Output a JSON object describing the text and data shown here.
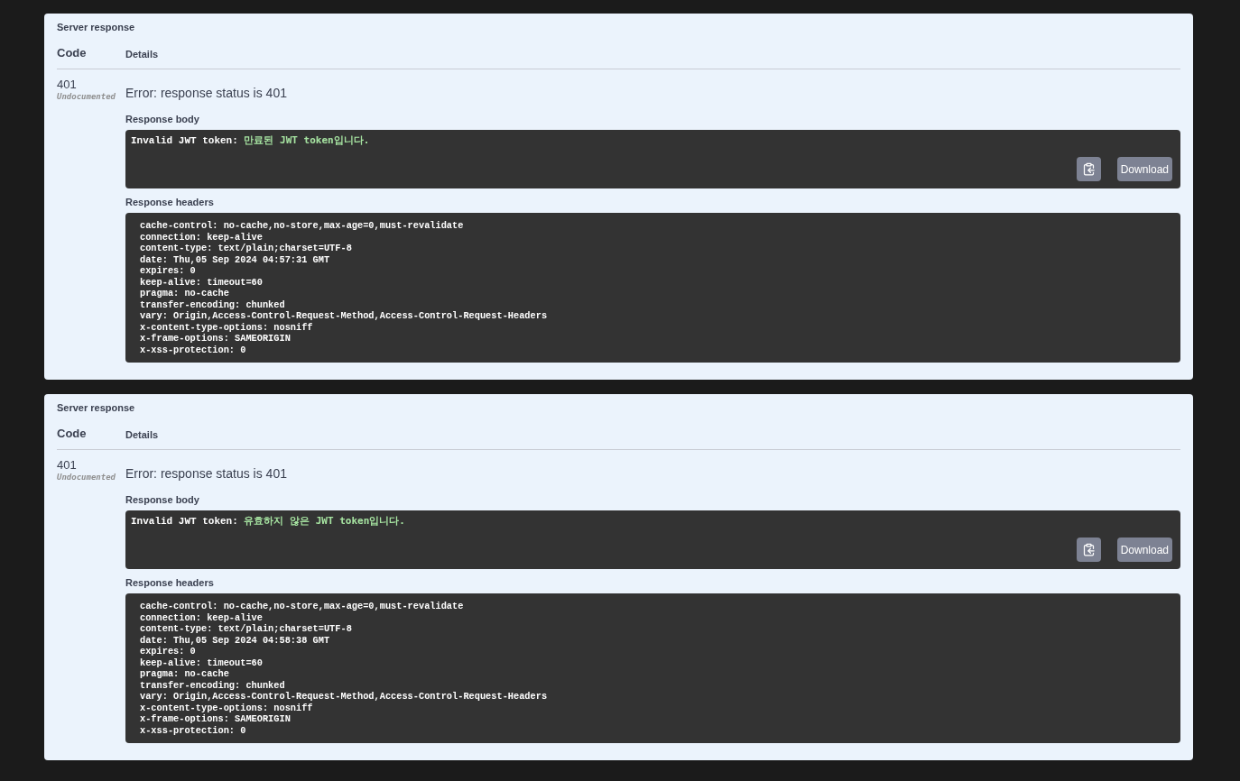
{
  "responses": [
    {
      "section_title": "Server response",
      "columns": [
        "Code",
        "Details"
      ],
      "code": "401",
      "code_note": "Undocumented",
      "error": "Error: response status is 401",
      "body_label": "Response body",
      "body": {
        "prefix": "Invalid JWT token: ",
        "message": "만료된 JWT token입니다."
      },
      "download": "Download",
      "headers_label": "Response headers",
      "headers": [
        "cache-control: no-cache,no-store,max-age=0,must-revalidate",
        "connection: keep-alive",
        "content-type: text/plain;charset=UTF-8",
        "date: Thu,05 Sep 2024 04:57:31 GMT",
        "expires: 0",
        "keep-alive: timeout=60",
        "pragma: no-cache",
        "transfer-encoding: chunked",
        "vary: Origin,Access-Control-Request-Method,Access-Control-Request-Headers",
        "x-content-type-options: nosniff",
        "x-frame-options: SAMEORIGIN",
        "x-xss-protection: 0"
      ]
    },
    {
      "section_title": "Server response",
      "columns": [
        "Code",
        "Details"
      ],
      "code": "401",
      "code_note": "Undocumented",
      "error": "Error: response status is 401",
      "body_label": "Response body",
      "body": {
        "prefix": "Invalid JWT token: ",
        "message": "유효하지 않은 JWT token입니다."
      },
      "download": "Download",
      "headers_label": "Response headers",
      "headers": [
        "cache-control: no-cache,no-store,max-age=0,must-revalidate",
        "connection: keep-alive",
        "content-type: text/plain;charset=UTF-8",
        "date: Thu,05 Sep 2024 04:58:38 GMT",
        "expires: 0",
        "keep-alive: timeout=60",
        "pragma: no-cache",
        "transfer-encoding: chunked",
        "vary: Origin,Access-Control-Request-Method,Access-Control-Request-Headers",
        "x-content-type-options: nosniff",
        "x-frame-options: SAMEORIGIN",
        "x-xss-protection: 0"
      ]
    }
  ]
}
